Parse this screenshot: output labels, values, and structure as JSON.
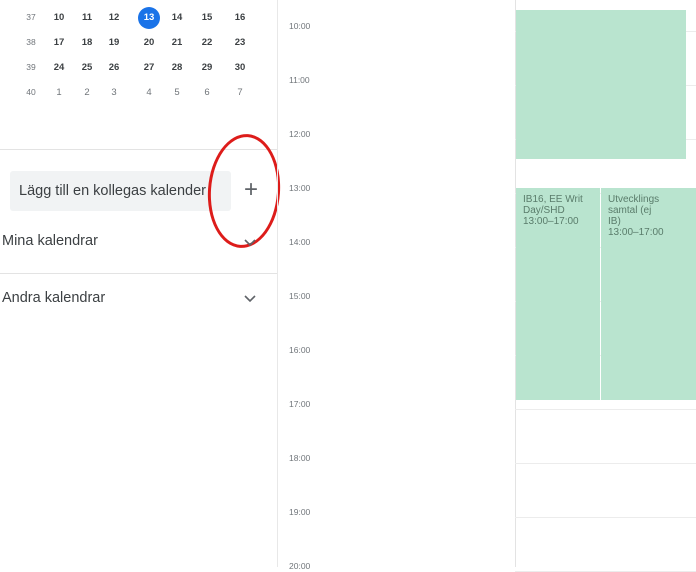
{
  "mini_calendar": {
    "weeks": [
      {
        "week": "37",
        "days": [
          {
            "d": "10"
          },
          {
            "d": "11"
          },
          {
            "d": "12"
          },
          {
            "d": "13",
            "today": true
          },
          {
            "d": "14"
          },
          {
            "d": "15"
          },
          {
            "d": "16"
          }
        ]
      },
      {
        "week": "38",
        "days": [
          {
            "d": "17"
          },
          {
            "d": "18"
          },
          {
            "d": "19"
          },
          {
            "d": "20"
          },
          {
            "d": "21"
          },
          {
            "d": "22"
          },
          {
            "d": "23"
          }
        ]
      },
      {
        "week": "39",
        "days": [
          {
            "d": "24"
          },
          {
            "d": "25"
          },
          {
            "d": "26"
          },
          {
            "d": "27"
          },
          {
            "d": "28"
          },
          {
            "d": "29"
          },
          {
            "d": "30"
          }
        ]
      },
      {
        "week": "40",
        "days": [
          {
            "d": "1",
            "other": true
          },
          {
            "d": "2",
            "other": true
          },
          {
            "d": "3",
            "other": true
          },
          {
            "d": "4",
            "other": true
          },
          {
            "d": "5",
            "other": true
          },
          {
            "d": "6",
            "other": true
          },
          {
            "d": "7",
            "other": true
          }
        ]
      }
    ]
  },
  "sidebar": {
    "add_colleague_label": "Lägg till en kollegas kalender",
    "add_icon": "plus-icon",
    "my_calendars_label": "Mina kalendrar",
    "other_calendars_label": "Andra kalendrar"
  },
  "times": [
    "10:00",
    "11:00",
    "12:00",
    "13:00",
    "14:00",
    "15:00",
    "16:00",
    "17:00",
    "18:00",
    "19:00",
    "20:00"
  ],
  "events": [
    {
      "lines": []
    },
    {
      "lines": [
        "IB16, EE Writ",
        "Day/SHD",
        "13:00–17:00"
      ]
    },
    {
      "lines": [
        "Utvecklings",
        "samtal (ej",
        "IB)",
        "13:00–17:00"
      ]
    }
  ],
  "colors": {
    "today": "#1a73e8",
    "event": "#b9e4cf",
    "annotation": "#dd1c1a"
  }
}
